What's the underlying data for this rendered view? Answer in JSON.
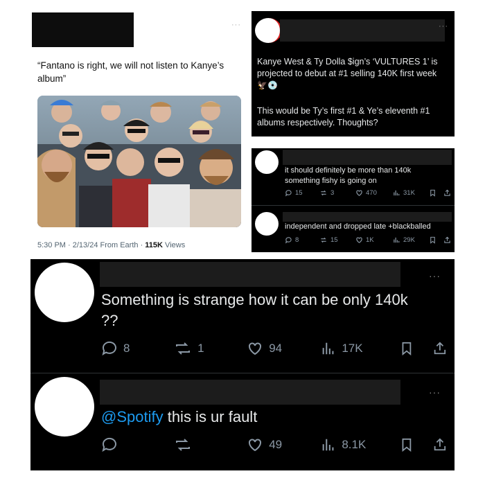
{
  "tweet_fantano": {
    "text": "“Fantano is right, we will not listen to Kanye’s album”",
    "more": "···",
    "timestamp": "5:30 PM · 2/13/24 From Earth · ",
    "views_count": "115K",
    "views_label": " Views"
  },
  "tweet_vultures": {
    "text1": "Kanye West & Ty Dolla $ign’s ‘VULTURES 1’ is projected to debut at #1 selling 140K first week",
    "emoji": "🦅💿",
    "text2": "This would be Ty’s first #1 & Ye’s eleventh #1 albums respectively. Thoughts?",
    "more": "···"
  },
  "reply_fishy": {
    "text": "it should definitely be more than 140k something fishy is going on",
    "replies": "15",
    "reposts": "3",
    "likes": "470",
    "views": "31K"
  },
  "reply_independent": {
    "text": "independent and dropped late +blackballed",
    "replies": "8",
    "reposts": "15",
    "likes": "1K",
    "views": "29K"
  },
  "reply_strange": {
    "text": "Something is strange how it can be only 140k ??",
    "more": "···",
    "replies": "8",
    "reposts": "1",
    "likes": "94",
    "views": "17K"
  },
  "reply_spotify": {
    "mention": "@Spotify",
    "text": " this is ur fault",
    "more": "···",
    "likes": "49",
    "views": "8.1K"
  },
  "colors": {
    "background": "#000000",
    "link": "#1d9bf0",
    "icon": "#8b98a5"
  }
}
